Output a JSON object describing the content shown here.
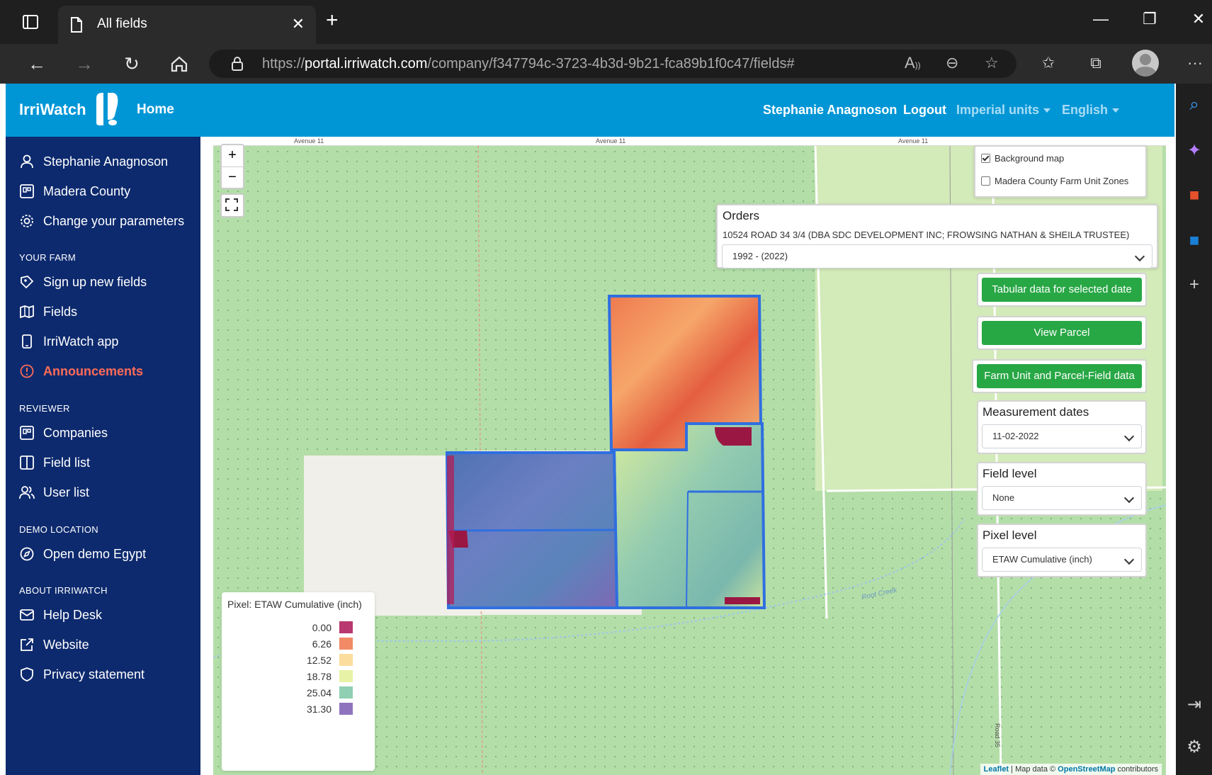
{
  "browser": {
    "tab_title": "All fields",
    "url_prefix": "https://",
    "url_host": "portal.irriwatch.com",
    "url_path": "/company/f347794c-3723-4b3d-9b21-fca89b1f0c47/fields#"
  },
  "header": {
    "logo": "IrriWatch",
    "home": "Home",
    "user": "Stephanie Anagnoson",
    "logout": "Logout",
    "units": "Imperial units",
    "language": "English"
  },
  "sidebar": {
    "items_top": [
      {
        "label": "Stephanie Anagnoson",
        "icon": "user-icon"
      },
      {
        "label": "Madera County",
        "icon": "company-icon"
      },
      {
        "label": "Change your parameters",
        "icon": "gear-icon"
      }
    ],
    "your_farm": {
      "heading": "YOUR FARM",
      "items": [
        {
          "label": "Sign up new fields",
          "icon": "pen-icon"
        },
        {
          "label": "Fields",
          "icon": "map-icon"
        },
        {
          "label": "IrriWatch app",
          "icon": "phone-icon"
        },
        {
          "label": "Announcements",
          "icon": "alert-icon"
        }
      ]
    },
    "reviewer": {
      "heading": "REVIEWER",
      "items": [
        {
          "label": "Companies",
          "icon": "company-icon"
        },
        {
          "label": "Field list",
          "icon": "columns-icon"
        },
        {
          "label": "User list",
          "icon": "users-icon"
        }
      ]
    },
    "demo": {
      "heading": "DEMO LOCATION",
      "items": [
        {
          "label": "Open demo Egypt",
          "icon": "compass-icon"
        }
      ]
    },
    "about": {
      "heading": "ABOUT IRRIWATCH",
      "items": [
        {
          "label": "Help Desk",
          "icon": "mail-icon"
        },
        {
          "label": "Website",
          "icon": "external-link-icon"
        },
        {
          "label": "Privacy statement",
          "icon": "shield-icon"
        }
      ]
    }
  },
  "map": {
    "zoom_in": "+",
    "zoom_out": "−",
    "road_labels": [
      "Avenue 11",
      "Avenue 11",
      "Avenue 11"
    ],
    "road_label_vertical": "Road 35",
    "creek_label": "Root Creek",
    "layers": {
      "background_map": {
        "label": "Background map",
        "checked": true
      },
      "farm_unit_zones": {
        "label": "Madera County Farm Unit Zones",
        "checked": false
      }
    },
    "orders": {
      "title": "Orders",
      "subtitle": "10524 ROAD 34 3/4 (DBA SDC DEVELOPMENT INC; FROWSING NATHAN & SHEILA TRUSTEE)",
      "selected": "1992 - (2022)"
    },
    "buttons": {
      "tabular": "Tabular data for selected date",
      "view_parcel": "View Parcel",
      "farm_unit": "Farm Unit and Parcel-Field data"
    },
    "measurement_dates": {
      "label": "Measurement dates",
      "value": "11-02-2022"
    },
    "field_level": {
      "label": "Field level",
      "value": "None"
    },
    "pixel_level": {
      "label": "Pixel level",
      "value": "ETAW Cumulative (inch)"
    },
    "legend": {
      "title": "Pixel: ETAW Cumulative (inch)",
      "entries": [
        {
          "value": "0.00",
          "color": "#b8386f"
        },
        {
          "value": "6.26",
          "color": "#f28a66"
        },
        {
          "value": "12.52",
          "color": "#fbdd9e"
        },
        {
          "value": "18.78",
          "color": "#e8f2a6"
        },
        {
          "value": "25.04",
          "color": "#8fcfb2"
        },
        {
          "value": "31.30",
          "color": "#8f74bd"
        }
      ]
    },
    "attribution": {
      "leaflet": "Leaflet",
      "mid": " | Map data © ",
      "osm": "OpenStreetMap",
      "tail": " contributors"
    }
  }
}
